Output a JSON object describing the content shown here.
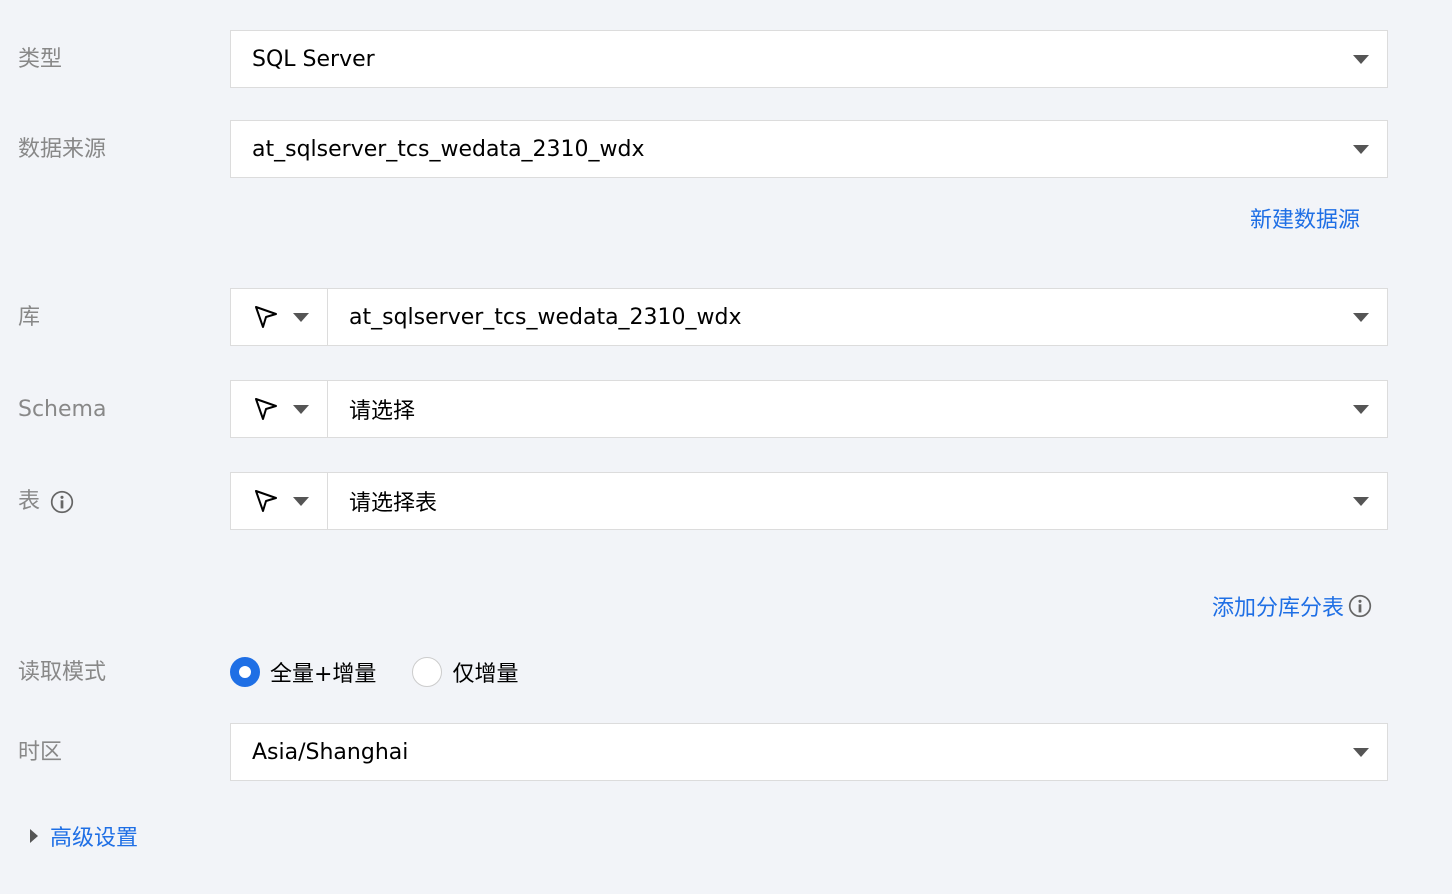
{
  "form": {
    "type": {
      "label": "类型",
      "value": "SQL Server"
    },
    "datasource": {
      "label": "数据来源",
      "value": "at_sqlserver_tcs_wedata_2310_wdx",
      "new_link": "新建数据源"
    },
    "database": {
      "label": "库",
      "value": "at_sqlserver_tcs_wedata_2310_wdx"
    },
    "schema": {
      "label": "Schema",
      "placeholder": "请选择"
    },
    "table": {
      "label": "表",
      "placeholder": "请选择表"
    },
    "add_sharding_link": "添加分库分表",
    "read_mode": {
      "label": "读取模式",
      "options": [
        {
          "label": "全量+增量",
          "selected": true
        },
        {
          "label": "仅增量",
          "selected": false
        }
      ]
    },
    "timezone": {
      "label": "时区",
      "value": "Asia/Shanghai"
    },
    "advanced_settings": "高级设置"
  },
  "colors": {
    "accent": "#1f6fe5",
    "background": "#f2f4f8",
    "label": "#888888",
    "placeholder": "#bbbbbb",
    "border": "#dcdcdc"
  },
  "icons": {
    "cursor": "cursor-arrow-icon",
    "caret": "caret-down-icon",
    "info": "info-icon",
    "expand": "caret-right-icon"
  }
}
